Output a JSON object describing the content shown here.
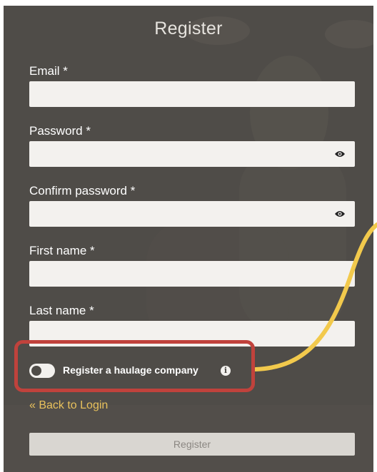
{
  "form": {
    "title": "Register",
    "fields": [
      {
        "label": "Email *",
        "value": "",
        "placeholder": ""
      },
      {
        "label": "Password *",
        "value": "",
        "placeholder": ""
      },
      {
        "label": "Confirm password *",
        "value": "",
        "placeholder": ""
      },
      {
        "label": "First name *",
        "value": "",
        "placeholder": ""
      },
      {
        "label": "Last name *",
        "value": "",
        "placeholder": ""
      }
    ],
    "haulage_toggle": {
      "label": "Register a haulage company",
      "checked": false
    },
    "info_icon_glyph": "i",
    "back_link": "« Back to Login",
    "submit_label": "Register"
  },
  "icons": {
    "password_reveal": "eye-icon",
    "confirm_password_reveal": "eye-icon",
    "haulage_info": "info-icon"
  },
  "colors": {
    "panel_background": "#4f4c48",
    "input_background": "#f3f1ee",
    "link": "#e8c15c",
    "highlight_border": "#c0423c",
    "callout_line": "#f2c94c"
  }
}
